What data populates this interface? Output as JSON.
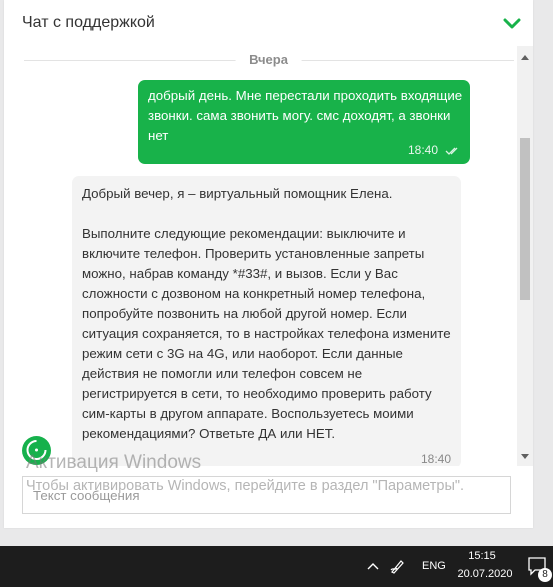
{
  "header": {
    "title": "Чат с поддержкой"
  },
  "messages": {
    "date_separator": "Вчера",
    "outgoing": {
      "text": "добрый день. Мне перестали проходить входящие звонки. сама звонить могу. смс доходят, а звонки нет",
      "time": "18:40"
    },
    "incoming": {
      "text": "Добрый вечер, я – виртуальный помощник Елена.\n\nВыполните следующие рекомендации: выключите и включите телефон. Проверить установленные запреты можно, набрав команду *#33#, и вызов. Если у Вас сложности с дозвоном на конкретный номер телефона, попробуйте позвонить на любой другой номер. Если ситуация сохраняется, то в настройках телефона измените режим сети с 3G на 4G, или наоборот. Если данные действия не помогли или телефон совсем не регистрируется в сети, то необходимо проверить работу сим-карты в другом аппарате. Воспользуетесь моими рекомендациями? Ответьте ДА или НЕТ.",
      "time": "18:40"
    }
  },
  "input": {
    "placeholder": "Текст сообщения",
    "value": ""
  },
  "watermark": {
    "title": "Активация Windows",
    "subtitle": "Чтобы активировать Windows, перейдите в раздел \"Параметры\"."
  },
  "taskbar": {
    "language": "ENG",
    "time": "15:15",
    "date": "20.07.2020",
    "notification_count": "8"
  },
  "colors": {
    "accent": "#18b24a",
    "incoming_bg": "#f3f3f3",
    "taskbar": "#1d1d1d"
  }
}
